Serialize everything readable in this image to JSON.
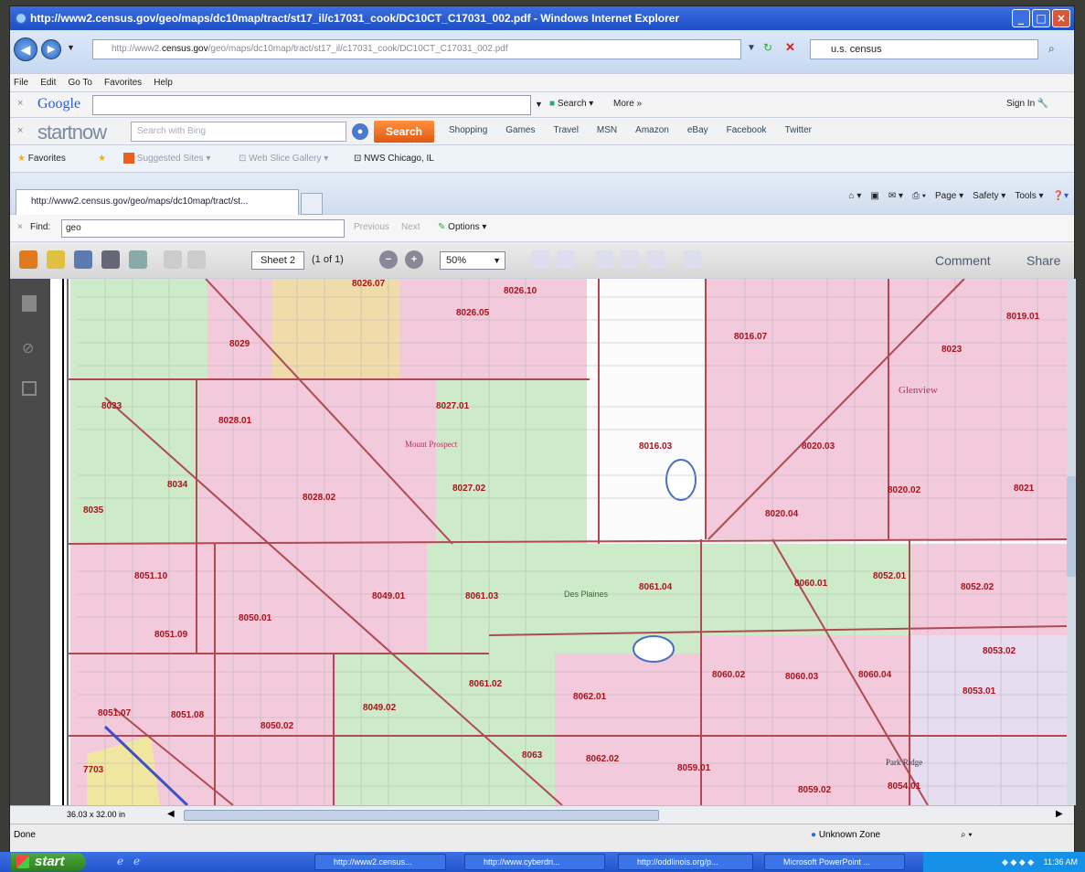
{
  "window": {
    "title": "http://www2.census.gov/geo/maps/dc10map/tract/st17_il/c17031_cook/DC10CT_C17031_002.pdf - Windows Internet Explorer"
  },
  "address_bar": {
    "url_prefix": "http://www2.",
    "url_domain": "census.gov",
    "url_rest": "/geo/maps/dc10map/tract/st17_il/c17031_cook/DC10CT_C17031_002.pdf",
    "search_value": "u.s. census"
  },
  "menu": [
    "File",
    "Edit",
    "Go To",
    "Favorites",
    "Help"
  ],
  "google_bar": {
    "logo": "Google",
    "search_label": "Search",
    "more_label": "More »",
    "signin_label": "Sign In"
  },
  "startnow_bar": {
    "logo": "startnow",
    "search_placeholder": "Search with Bing",
    "search_button": "Search",
    "links": [
      "Shopping",
      "Games",
      "Travel",
      "MSN",
      "Amazon",
      "eBay",
      "Facebook",
      "Twitter"
    ]
  },
  "favorites_bar": {
    "favorites_label": "Favorites",
    "suggested_sites": "Suggested Sites",
    "web_slice": "Web Slice Gallery",
    "nws": "NWS Chicago, IL"
  },
  "tab": {
    "label": "http://www2.census.gov/geo/maps/dc10map/tract/st...",
    "commands": [
      "Page",
      "Safety",
      "Tools"
    ]
  },
  "find_bar": {
    "label": "Find:",
    "value": "geo",
    "previous": "Previous",
    "next": "Next",
    "options": "Options"
  },
  "pdf_toolbar": {
    "sheet": "Sheet 2",
    "page_count": "(1 of 1)",
    "zoom": "50%",
    "comment": "Comment",
    "share": "Share"
  },
  "map": {
    "tracts": [
      "8026.07",
      "8026.10",
      "8026.05",
      "8019.01",
      "8029",
      "8016.07",
      "8023",
      "8033",
      "8028.01",
      "8027.01",
      "8016.03",
      "8020.03",
      "8034",
      "8027.02",
      "8028.02",
      "8020.02",
      "8021",
      "8035",
      "8020.04",
      "8051.10",
      "8049.01",
      "8061.03",
      "8061.04",
      "8060.01",
      "8052.01",
      "8052.02",
      "8050.01",
      "8051.09",
      "8053.02",
      "8061.02",
      "8060.02",
      "8060.03",
      "8060.04",
      "8053.01",
      "8051.07",
      "8051.08",
      "8049.02",
      "8062.01",
      "8050.02",
      "8063",
      "8062.02",
      "8059.01",
      "8059.02",
      "8054.01",
      "7703"
    ],
    "places": [
      "Glenview",
      "Des Plaines",
      "Park Ridge",
      "Mount Prospect"
    ],
    "page_size": "36.03 x 32.00 in"
  },
  "status_bar": {
    "status": "Done",
    "zone": "Unknown Zone"
  },
  "taskbar": {
    "start": "start",
    "items": [
      "http://www2.census...",
      "http://www.cyberdri...",
      "http://oddlinois.org/p...",
      "Microsoft PowerPoint ..."
    ],
    "clock": "11:36 AM"
  },
  "colors": {
    "title_blue": "#1d4fc4",
    "tract_label": "#a4141c",
    "tract_line": "#b04a52",
    "land_pink": "#f3c9dc",
    "land_green": "#cdebc9",
    "land_tan": "#f0dcaa",
    "start_green": "#3a9a2e"
  }
}
